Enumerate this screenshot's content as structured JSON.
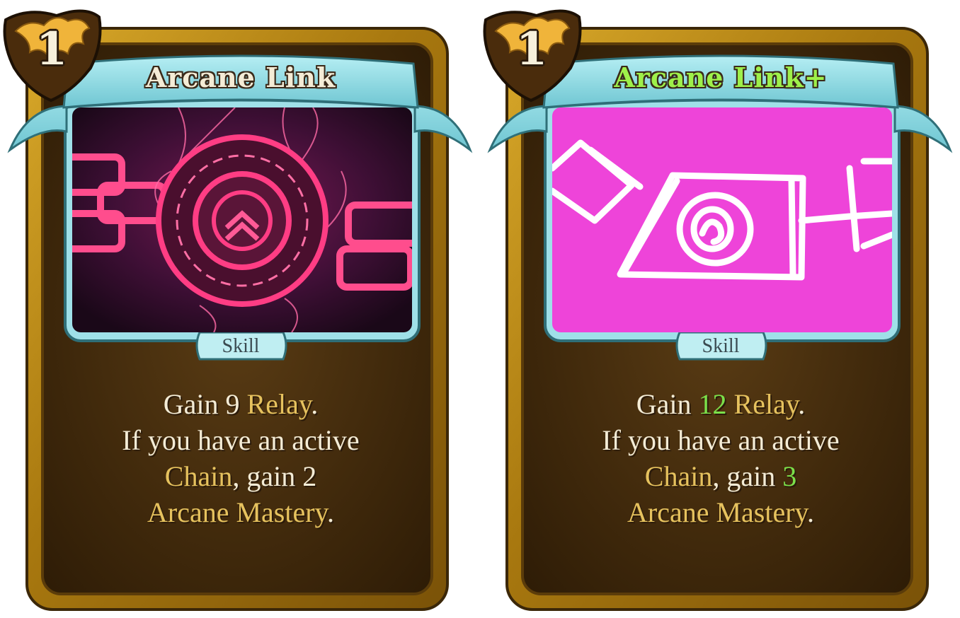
{
  "colors": {
    "frame_gold": "#b8860b",
    "frame_dark": "#3b2708",
    "banner": "#8fd6df",
    "keyword": "#e6c25e",
    "upgraded": "#7be04a",
    "art_upgraded_bg": "#ee44d9",
    "art_base_glow": "#ff4d8d",
    "title_base": "#f4ecd6",
    "title_upgraded": "#9ef04a"
  },
  "cards": [
    {
      "cost": "1",
      "title": "Arcane Link",
      "type": "Skill",
      "art": "arcane-chain-sigil",
      "description": {
        "l1a": "Gain ",
        "l1b": "9",
        "l1c": "Relay",
        "l1d": ".",
        "l2": "If you have an active",
        "l3a": "Chain",
        "l3b": ", gain ",
        "l3c": "2",
        "l4a": "Arcane Mastery",
        "l4b": "."
      }
    },
    {
      "cost": "1",
      "title": "Arcane Link+",
      "type": "Skill",
      "art": "placeholder-sketch",
      "description": {
        "l1a": "Gain ",
        "l1b": "12",
        "l1c": "Relay",
        "l1d": ".",
        "l2": "If you have an active",
        "l3a": "Chain",
        "l3b": ", gain ",
        "l3c": "3",
        "l4a": "Arcane Mastery",
        "l4b": "."
      }
    }
  ]
}
